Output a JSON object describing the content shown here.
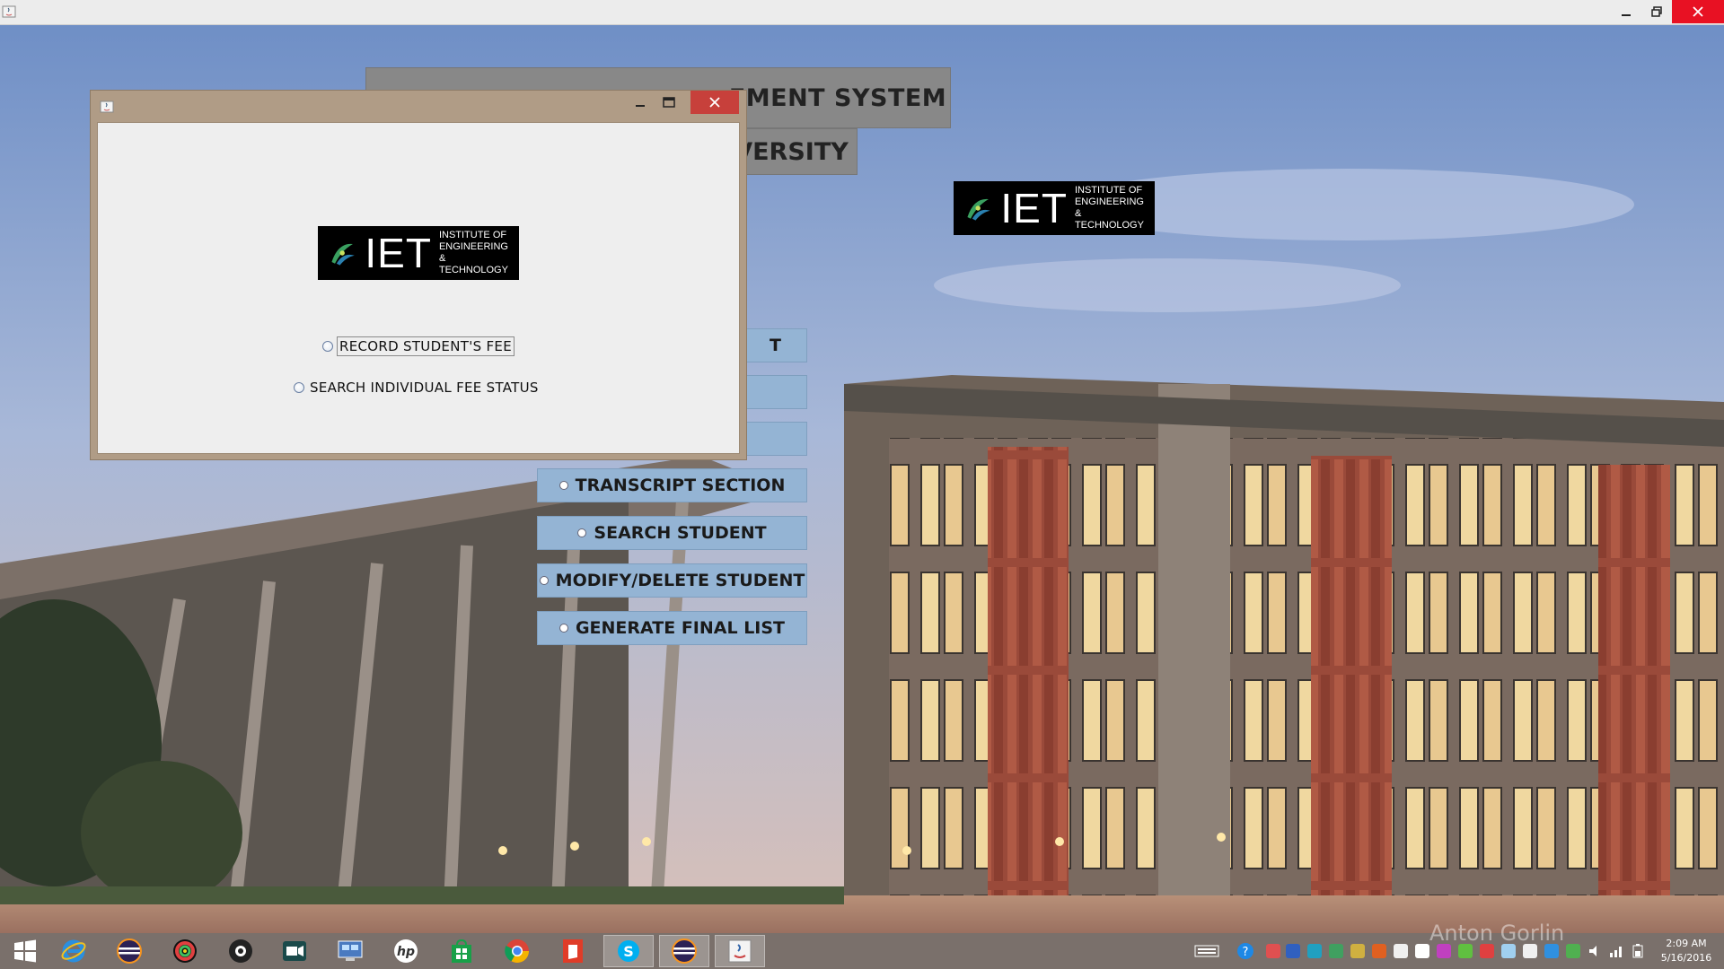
{
  "main_window": {
    "title_controls": {
      "minimize": "minimize",
      "maximize": "maximize",
      "close": "close"
    },
    "title_text": "EMENT SYSTEM",
    "subtitle_text": "VERSITY",
    "logo": {
      "big": "IET",
      "small_lines": [
        "INSTITUTE OF",
        "ENGINEERING &",
        "TECHNOLOGY"
      ]
    },
    "menu": [
      {
        "label": "T",
        "visible_partial": true
      },
      {
        "label": "",
        "visible_partial": true
      },
      {
        "label": "",
        "visible_partial": true
      },
      {
        "label": "TRANSCRIPT SECTION"
      },
      {
        "label": "SEARCH STUDENT"
      },
      {
        "label": "MODIFY/DELETE STUDENT"
      },
      {
        "label": "GENERATE FINAL LIST"
      }
    ]
  },
  "dialog": {
    "logo": {
      "big": "IET",
      "small_lines": [
        "INSTITUTE OF",
        "ENGINEERING &",
        "TECHNOLOGY"
      ]
    },
    "options": [
      {
        "label": "RECORD STUDENT'S FEE",
        "focused": true
      },
      {
        "label": "SEARCH INDIVIDUAL FEE STATUS",
        "focused": false
      }
    ]
  },
  "taskbar": {
    "apps": [
      "start-button",
      "internet-explorer",
      "eclipse",
      "color-wheel-app",
      "camera-app",
      "video-app",
      "remote-desktop",
      "hp-app",
      "store",
      "chrome",
      "office-app",
      "skype",
      "eclipse-2",
      "java-app"
    ],
    "clock": {
      "time": "2:09 AM",
      "date": "5/16/2016"
    },
    "watermark": "Anton Gorlin"
  },
  "colors": {
    "dialog_frame": "#b09c86",
    "dialog_close": "#c7403b",
    "menu_button": "#94b4d4",
    "title_label_bg": "#888888"
  }
}
